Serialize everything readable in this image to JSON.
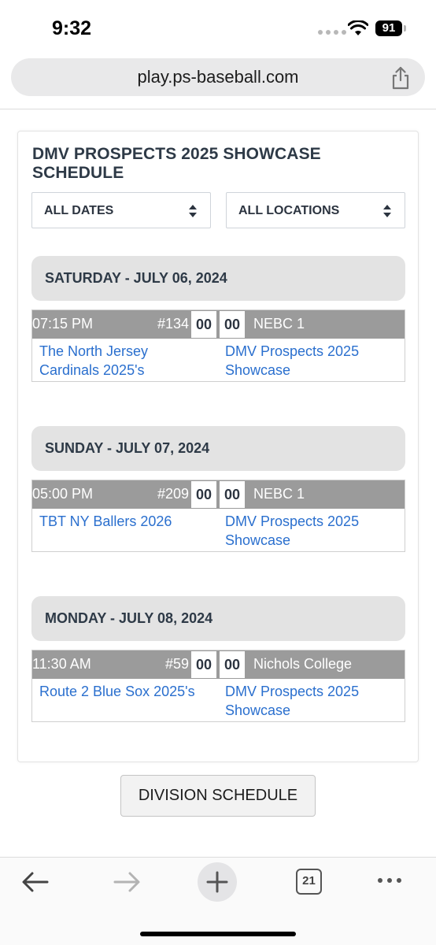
{
  "status_bar": {
    "time": "9:32",
    "battery": "91"
  },
  "browser": {
    "url": "play.ps-baseball.com",
    "tab_count": "21"
  },
  "schedule": {
    "title": "DMV PROSPECTS 2025 SHOWCASE SCHEDULE",
    "filters": {
      "dates": "ALL DATES",
      "locations": "ALL LOCATIONS"
    },
    "days": [
      {
        "label": "SATURDAY - JULY 06, 2024",
        "game": {
          "time": "07:15 PM",
          "number": "#134",
          "score_home": "00",
          "score_away": "00",
          "location": "NEBC 1",
          "team_a": "The North Jersey Cardinals 2025's",
          "team_b": "DMV Prospects 2025 Showcase"
        }
      },
      {
        "label": "SUNDAY - JULY 07, 2024",
        "game": {
          "time": "05:00 PM",
          "number": "#209",
          "score_home": "00",
          "score_away": "00",
          "location": "NEBC 1",
          "team_a": "TBT NY Ballers 2026",
          "team_b": "DMV Prospects 2025 Showcase"
        }
      },
      {
        "label": "MONDAY - JULY 08, 2024",
        "game": {
          "time": "11:30 AM",
          "number": "#59",
          "score_home": "00",
          "score_away": "00",
          "location": "Nichols College",
          "team_a": "Route 2 Blue Sox 2025's",
          "team_b": "DMV Prospects 2025 Showcase"
        }
      }
    ]
  },
  "division_button": "DIVISION SCHEDULE",
  "colors": {
    "link": "#2a6fce",
    "game_bar": "#9b9b9b",
    "day_header": "#e3e3e3",
    "title": "#2e3a47"
  }
}
